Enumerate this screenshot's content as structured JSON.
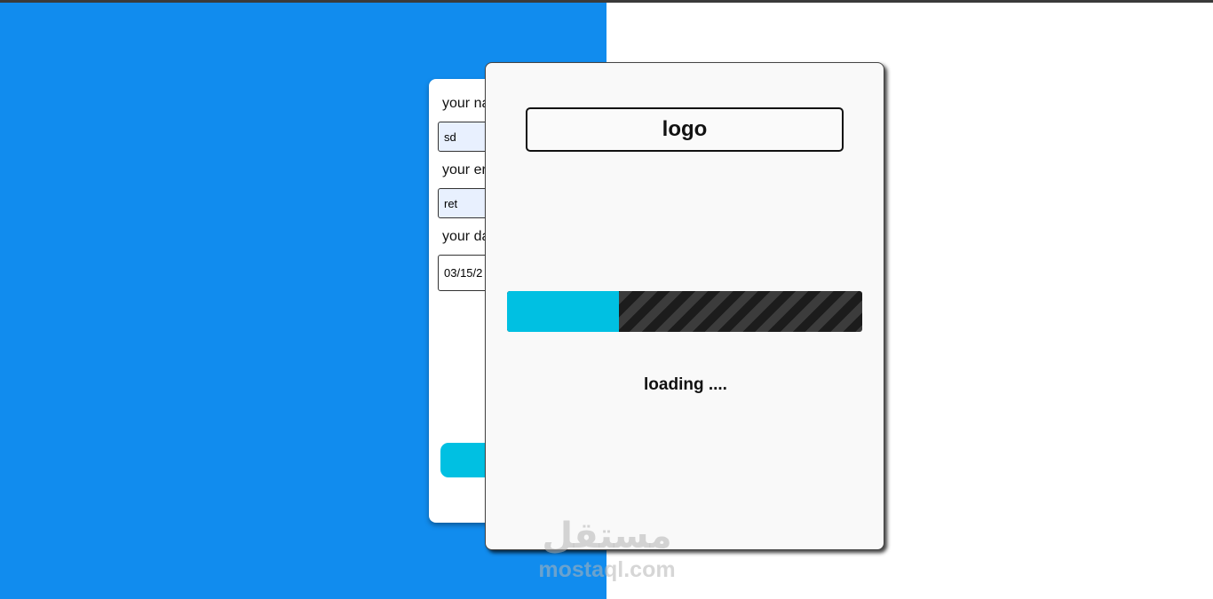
{
  "form": {
    "name_label": "your na",
    "name_value": "sd",
    "email_label": "your er",
    "email_value": "ret",
    "date_label": "your da",
    "date_value": "03/15/2"
  },
  "loader": {
    "logo_text": "logo",
    "loading_text": "loading ....",
    "progress_percent": 31.5
  },
  "watermark": {
    "arabic": "مستقل",
    "latin": "mostaql.com"
  },
  "colors": {
    "background_blue": "#118cee",
    "accent_cyan": "#00c0e2",
    "track_dark": "#1c1c1c",
    "track_stripe": "#3c3c3c"
  }
}
